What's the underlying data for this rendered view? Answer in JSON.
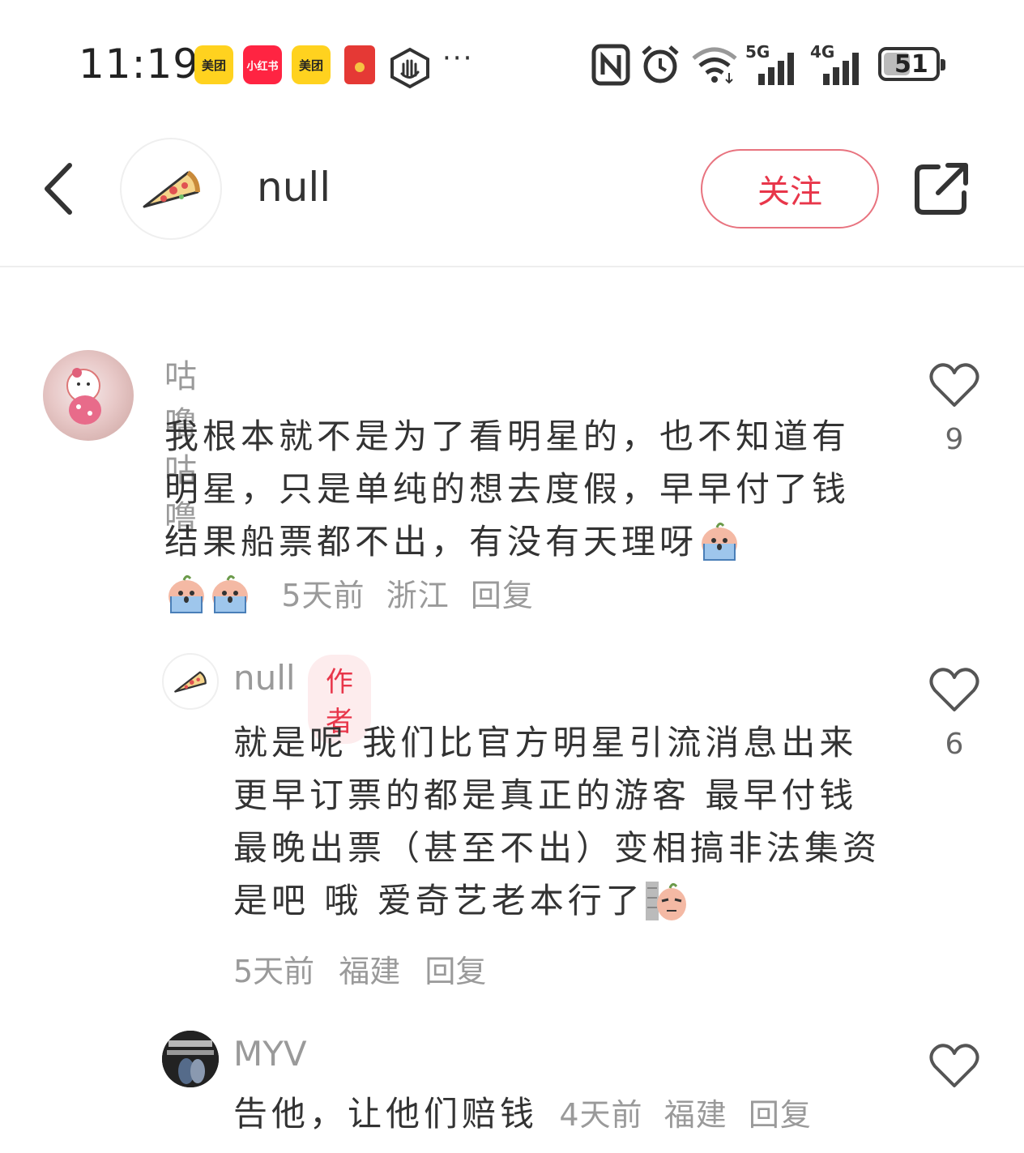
{
  "status_bar": {
    "time": "11:19",
    "apps": [
      {
        "icon": "meituan-icon",
        "label": "美团"
      },
      {
        "icon": "xiaohongshu-icon",
        "label": "小红书"
      },
      {
        "icon": "meituan-icon",
        "label": "美团"
      },
      {
        "icon": "red-packet-icon",
        "label": ""
      },
      {
        "icon": "hand-stop-icon",
        "label": ""
      }
    ],
    "more": "···",
    "network_5g": "5G",
    "network_4g": "4G",
    "battery": "51",
    "battery_level": 0.51
  },
  "header": {
    "username": "null",
    "follow_label": "关注"
  },
  "comments": [
    {
      "user": "咕噜咕噜",
      "text": "我根本就不是为了看明星的，也不知道有明星，只是单纯的想去度假，早早付了钱 结果船票都不出，有没有天理呀",
      "time": "5天前",
      "location": "浙江",
      "reply": "回复",
      "likes": "9"
    },
    {
      "user": "null",
      "badge": "作者",
      "text": "就是呢 我们比官方明星引流消息出来更早订票的都是真正的游客 最早付钱 最晚出票（甚至不出）变相搞非法集资是吧 哦 爱奇艺老本行了",
      "time": "5天前",
      "location": "福建",
      "reply": "回复",
      "likes": "6"
    },
    {
      "user": "MYV",
      "text": "告他，让他们赔钱",
      "time": "4天前",
      "location": "福建",
      "reply": "回复",
      "likes": ""
    }
  ]
}
